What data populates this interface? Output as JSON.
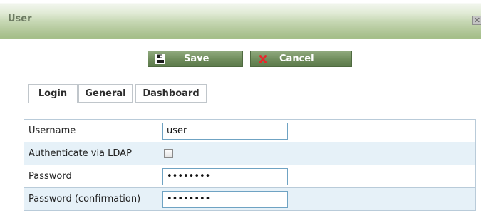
{
  "dialog": {
    "title": "User",
    "close_glyph": "✕"
  },
  "toolbar": {
    "save_label": "Save",
    "save_icon": "floppy-disk-icon",
    "cancel_label": "Cancel",
    "cancel_icon": "red-x-icon",
    "button_color": "#6f8c5c"
  },
  "tabs": [
    {
      "label": "Login",
      "active": true
    },
    {
      "label": "General",
      "active": false
    },
    {
      "label": "Dashboard",
      "active": false
    }
  ],
  "form": {
    "rows": [
      {
        "label": "Username",
        "type": "text",
        "value": "user"
      },
      {
        "label": "Authenticate via LDAP",
        "type": "checkbox",
        "checked": false
      },
      {
        "label": "Password",
        "type": "password",
        "value": "••••••••"
      },
      {
        "label": "Password (confirmation)",
        "type": "password",
        "value": "••••••••"
      }
    ],
    "alt_row_color": "#e6f1f8",
    "input_border_color": "#6fa3c3"
  }
}
